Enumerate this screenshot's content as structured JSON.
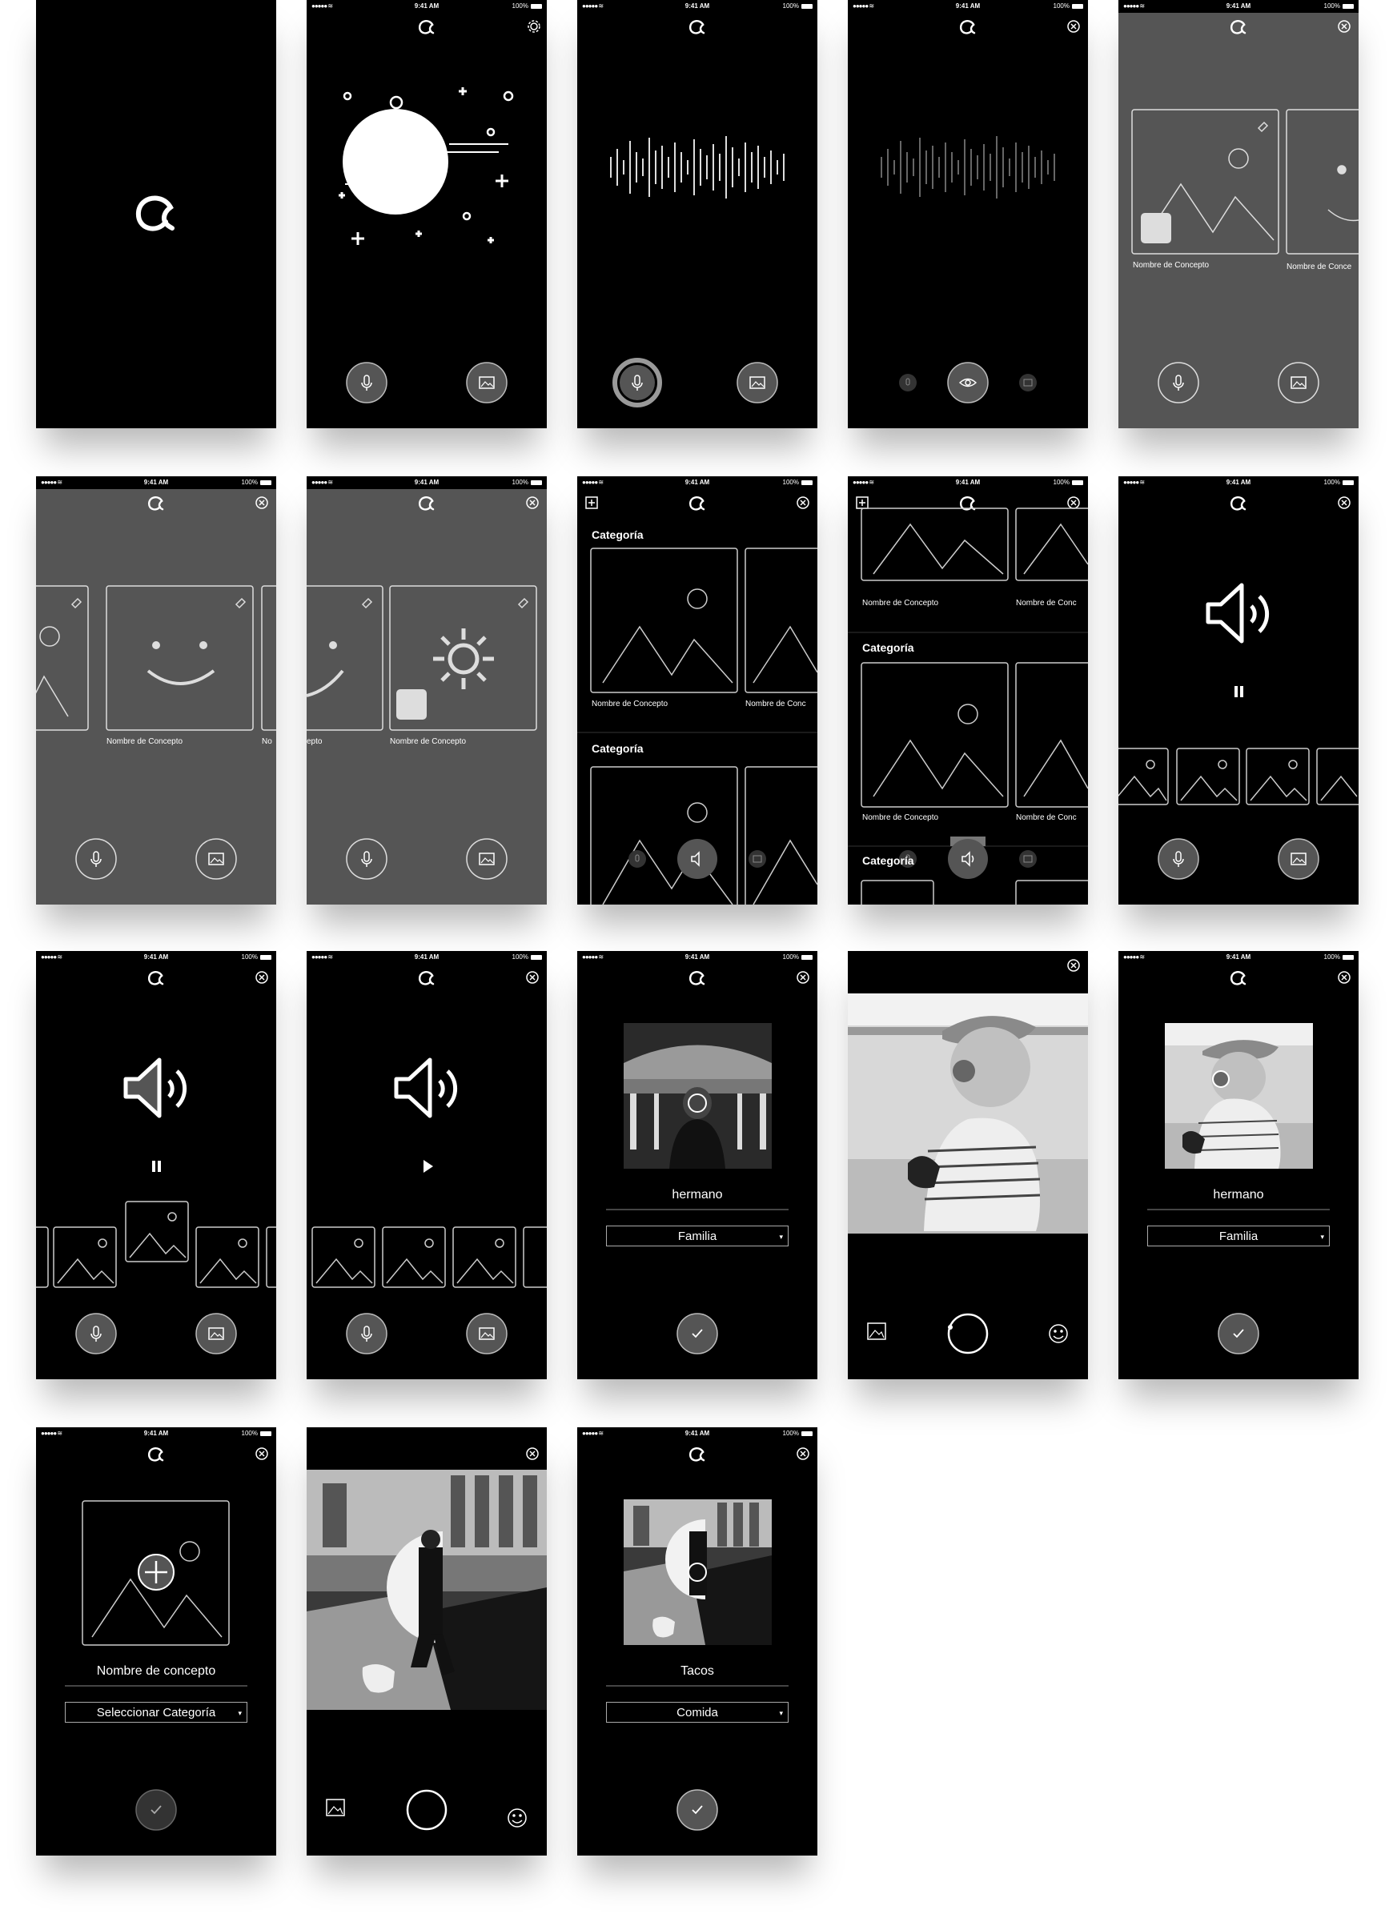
{
  "status_bar": {
    "signal": "●●●●● ≋",
    "time": "9:41 AM",
    "battery": "100%"
  },
  "icons": {
    "logo": "logo-icon",
    "settings": "gear-icon",
    "close": "close-icon",
    "mic": "microphone-icon",
    "gallery": "image-icon",
    "add": "add-icon",
    "eye": "eye-icon",
    "speaker": "speaker-icon",
    "pause": "pause-icon",
    "play": "play-icon",
    "check": "check-icon",
    "shutter": "shutter-icon",
    "emoji": "emoji-icon",
    "edit": "pencil-icon"
  },
  "colors": {
    "screen_dark": "#000000",
    "screen_gray": "#555555",
    "button_fill": "#555555"
  },
  "concept_name": "Nombre de Concepto",
  "concept_name_trunc_a": "Nombre de Conce",
  "concept_name_trunc_b": "Nombre de Conc",
  "concept_name_trunc_c": "No",
  "concept_name_trunc_d": "epto",
  "category": "Categoría",
  "category_trunc": "Categoría",
  "form_brother": {
    "name": "hermano",
    "category": "Familia"
  },
  "form_new": {
    "name": "Nombre de concepto",
    "category": "Seleccionar Categoría"
  },
  "form_tacos": {
    "name": "Tacos",
    "category": "Comida"
  },
  "dropdown_arrow": "▾"
}
